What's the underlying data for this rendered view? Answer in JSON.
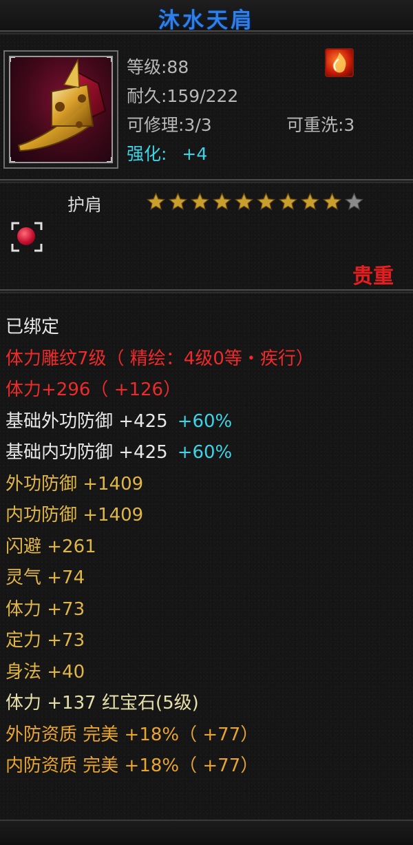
{
  "item": {
    "name": "沐水天肩",
    "level_text": "等级:88",
    "durability_text": "耐久:159/222",
    "repair_text": "可修理:3/3",
    "reroll_text": "可重洗:3",
    "enhance_label": "强化:",
    "enhance_value": "+4",
    "type": "护肩",
    "star_rating": 9,
    "star_max": 10,
    "quality": "贵重",
    "icon": "shoulder-armor-icon",
    "badge_icon": "fire-emblem-icon"
  },
  "attributes": [
    {
      "text": "已绑定",
      "color": "#e8e8e8"
    },
    {
      "text": "体力雕纹7级（ 精绘：4级0等・疾行）",
      "color": "#ee2a2a"
    },
    {
      "text": "体力+296（ +126）",
      "color": "#ee2a2a"
    },
    {
      "text": "基础外功防御  +425",
      "extra": "+60%",
      "color": "#e8e8e8"
    },
    {
      "text": "基础内功防御  +425",
      "extra": "+60%",
      "color": "#e8e8e8"
    },
    {
      "text": "外功防御  +1409",
      "color": "#e0b646"
    },
    {
      "text": "内功防御  +1409",
      "color": "#e0b646"
    },
    {
      "text": "闪避  +261",
      "color": "#e0b646"
    },
    {
      "text": "灵气  +74",
      "color": "#e0b646"
    },
    {
      "text": "体力  +73",
      "color": "#e0b646"
    },
    {
      "text": "定力  +73",
      "color": "#e0b646"
    },
    {
      "text": "身法  +40",
      "color": "#e0b646"
    },
    {
      "text": "体力  +137  红宝石(5级)",
      "color": "#e6e0a8"
    },
    {
      "text": "外防资质   完美  +18%（ +77）",
      "color": "#e8a532"
    },
    {
      "text": "内防资质   完美  +18%（ +77）",
      "color": "#e8a532"
    }
  ],
  "colors": {
    "title": "#2f7fe6",
    "enhance": "#3cd4e6",
    "quality": "#e81e1e",
    "star_on": "#c9a030",
    "star_off": "#8a8a8a"
  }
}
